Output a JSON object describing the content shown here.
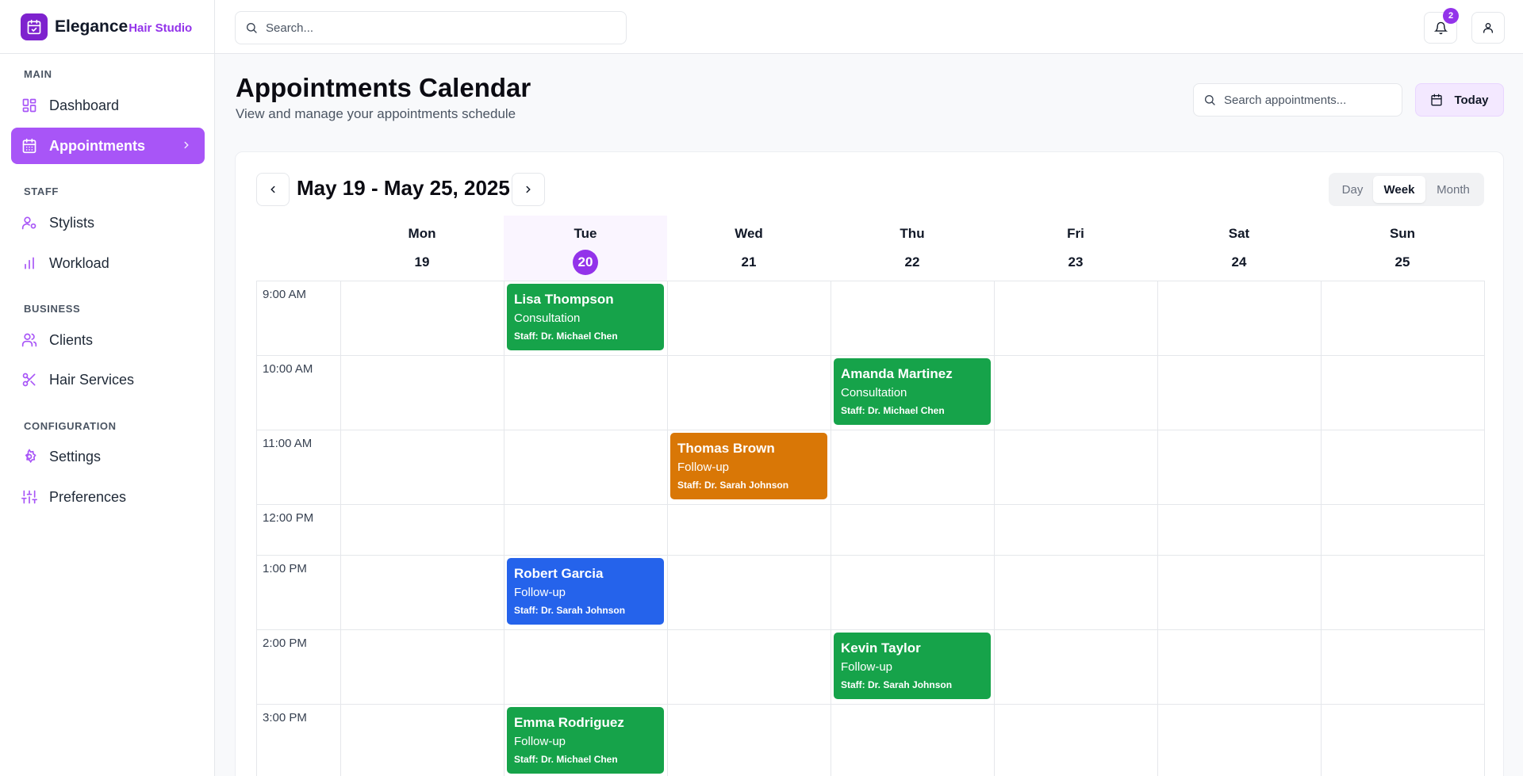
{
  "brand": {
    "name": "Elegance",
    "sub": "Hair Studio"
  },
  "search": {
    "placeholder": "Search..."
  },
  "notifications": {
    "count": "2"
  },
  "sidebar": {
    "sections": [
      {
        "title": "MAIN",
        "items": [
          {
            "label": "Dashboard",
            "icon": "dashboard-icon"
          },
          {
            "label": "Appointments",
            "icon": "calendar-icon",
            "active": true
          }
        ]
      },
      {
        "title": "STAFF",
        "items": [
          {
            "label": "Stylists",
            "icon": "user-gear-icon"
          },
          {
            "label": "Workload",
            "icon": "bar-chart-icon"
          }
        ]
      },
      {
        "title": "BUSINESS",
        "items": [
          {
            "label": "Clients",
            "icon": "users-icon"
          },
          {
            "label": "Hair Services",
            "icon": "scissors-icon"
          }
        ]
      },
      {
        "title": "CONFIGURATION",
        "items": [
          {
            "label": "Settings",
            "icon": "gear-icon"
          },
          {
            "label": "Preferences",
            "icon": "sliders-icon"
          }
        ]
      }
    ]
  },
  "page": {
    "title": "Appointments Calendar",
    "subtitle": "View and manage your appointments schedule"
  },
  "appt_search": {
    "placeholder": "Search appointments..."
  },
  "today_button": "Today",
  "calendar": {
    "range": "May 19 - May 25, 2025",
    "views": [
      "Day",
      "Week",
      "Month"
    ],
    "selected_view": "Week",
    "days": [
      {
        "name": "Mon",
        "date": "19"
      },
      {
        "name": "Tue",
        "date": "20",
        "today": true
      },
      {
        "name": "Wed",
        "date": "21"
      },
      {
        "name": "Thu",
        "date": "22"
      },
      {
        "name": "Fri",
        "date": "23"
      },
      {
        "name": "Sat",
        "date": "24"
      },
      {
        "name": "Sun",
        "date": "25"
      }
    ],
    "times": [
      "9:00 AM",
      "10:00 AM",
      "11:00 AM",
      "12:00 PM",
      "1:00 PM",
      "2:00 PM",
      "3:00 PM"
    ],
    "appointments": [
      {
        "client": "Lisa Thompson",
        "type": "Consultation",
        "staff": "Staff: Dr. Michael Chen",
        "day": 1,
        "slot": 0,
        "color": "#16a34a"
      },
      {
        "client": "Amanda Martinez",
        "type": "Consultation",
        "staff": "Staff: Dr. Michael Chen",
        "day": 3,
        "slot": 1,
        "color": "#16a34a"
      },
      {
        "client": "Thomas Brown",
        "type": "Follow-up",
        "staff": "Staff: Dr. Sarah Johnson",
        "day": 2,
        "slot": 2,
        "color": "#d97706"
      },
      {
        "client": "Robert Garcia",
        "type": "Follow-up",
        "staff": "Staff: Dr. Sarah Johnson",
        "day": 1,
        "slot": 4,
        "color": "#2563eb"
      },
      {
        "client": "Kevin Taylor",
        "type": "Follow-up",
        "staff": "Staff: Dr. Sarah Johnson",
        "day": 3,
        "slot": 5,
        "color": "#16a34a"
      },
      {
        "client": "Emma Rodriguez",
        "type": "Follow-up",
        "staff": "Staff: Dr. Michael Chen",
        "day": 1,
        "slot": 6,
        "color": "#16a34a"
      }
    ]
  },
  "colors": {
    "accent": "#9333ea",
    "active_nav": "#a855f7",
    "green": "#16a34a",
    "orange": "#d97706",
    "blue": "#2563eb"
  }
}
